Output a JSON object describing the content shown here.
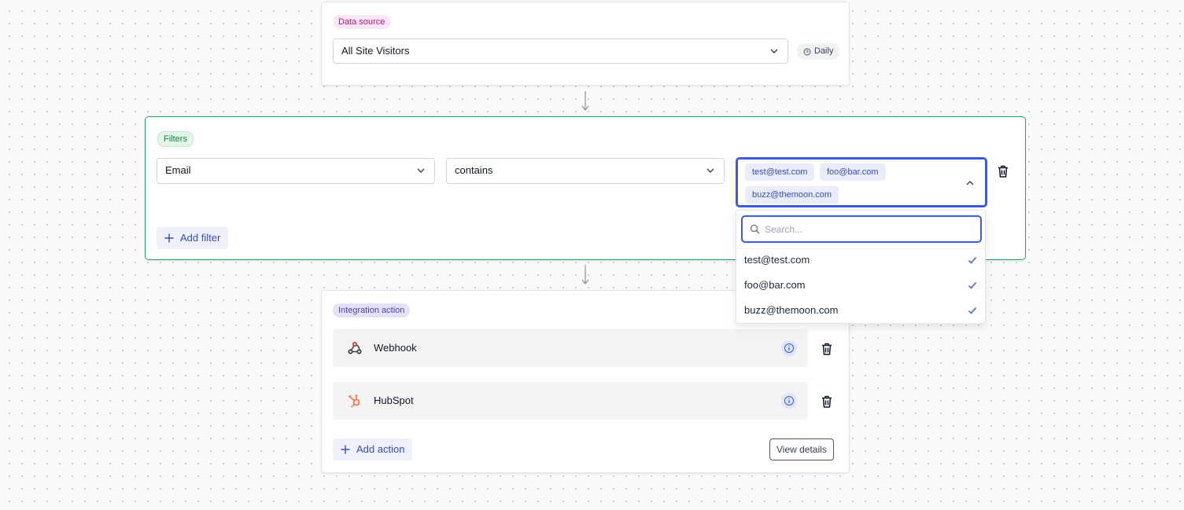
{
  "data_source": {
    "badge": "Data source",
    "select_value": "All Site Visitors",
    "schedule": "Daily"
  },
  "filters": {
    "badge": "Filters",
    "field": "Email",
    "operator": "contains",
    "chips": [
      "test@test.com",
      "foo@bar.com",
      "buzz@themoon.com"
    ],
    "add_label": "Add filter"
  },
  "dropdown": {
    "search_placeholder": "Search...",
    "options": [
      {
        "label": "test@test.com",
        "selected": true
      },
      {
        "label": "foo@bar.com",
        "selected": true
      },
      {
        "label": "buzz@themoon.com",
        "selected": true
      }
    ]
  },
  "integration": {
    "badge": "Integration action",
    "actions": [
      {
        "label": "Webhook",
        "icon": "webhook-icon"
      },
      {
        "label": "HubSpot",
        "icon": "hubspot-icon"
      }
    ],
    "add_label": "Add action",
    "details_label": "View details"
  },
  "colors": {
    "accent": "#3b5bdb",
    "filters_border": "#22a55b",
    "data_source_badge": "#fbe4f6",
    "filters_badge": "#e3f6ea",
    "integration_badge": "#e4e2fb",
    "hubspot": "#ff7a59"
  }
}
